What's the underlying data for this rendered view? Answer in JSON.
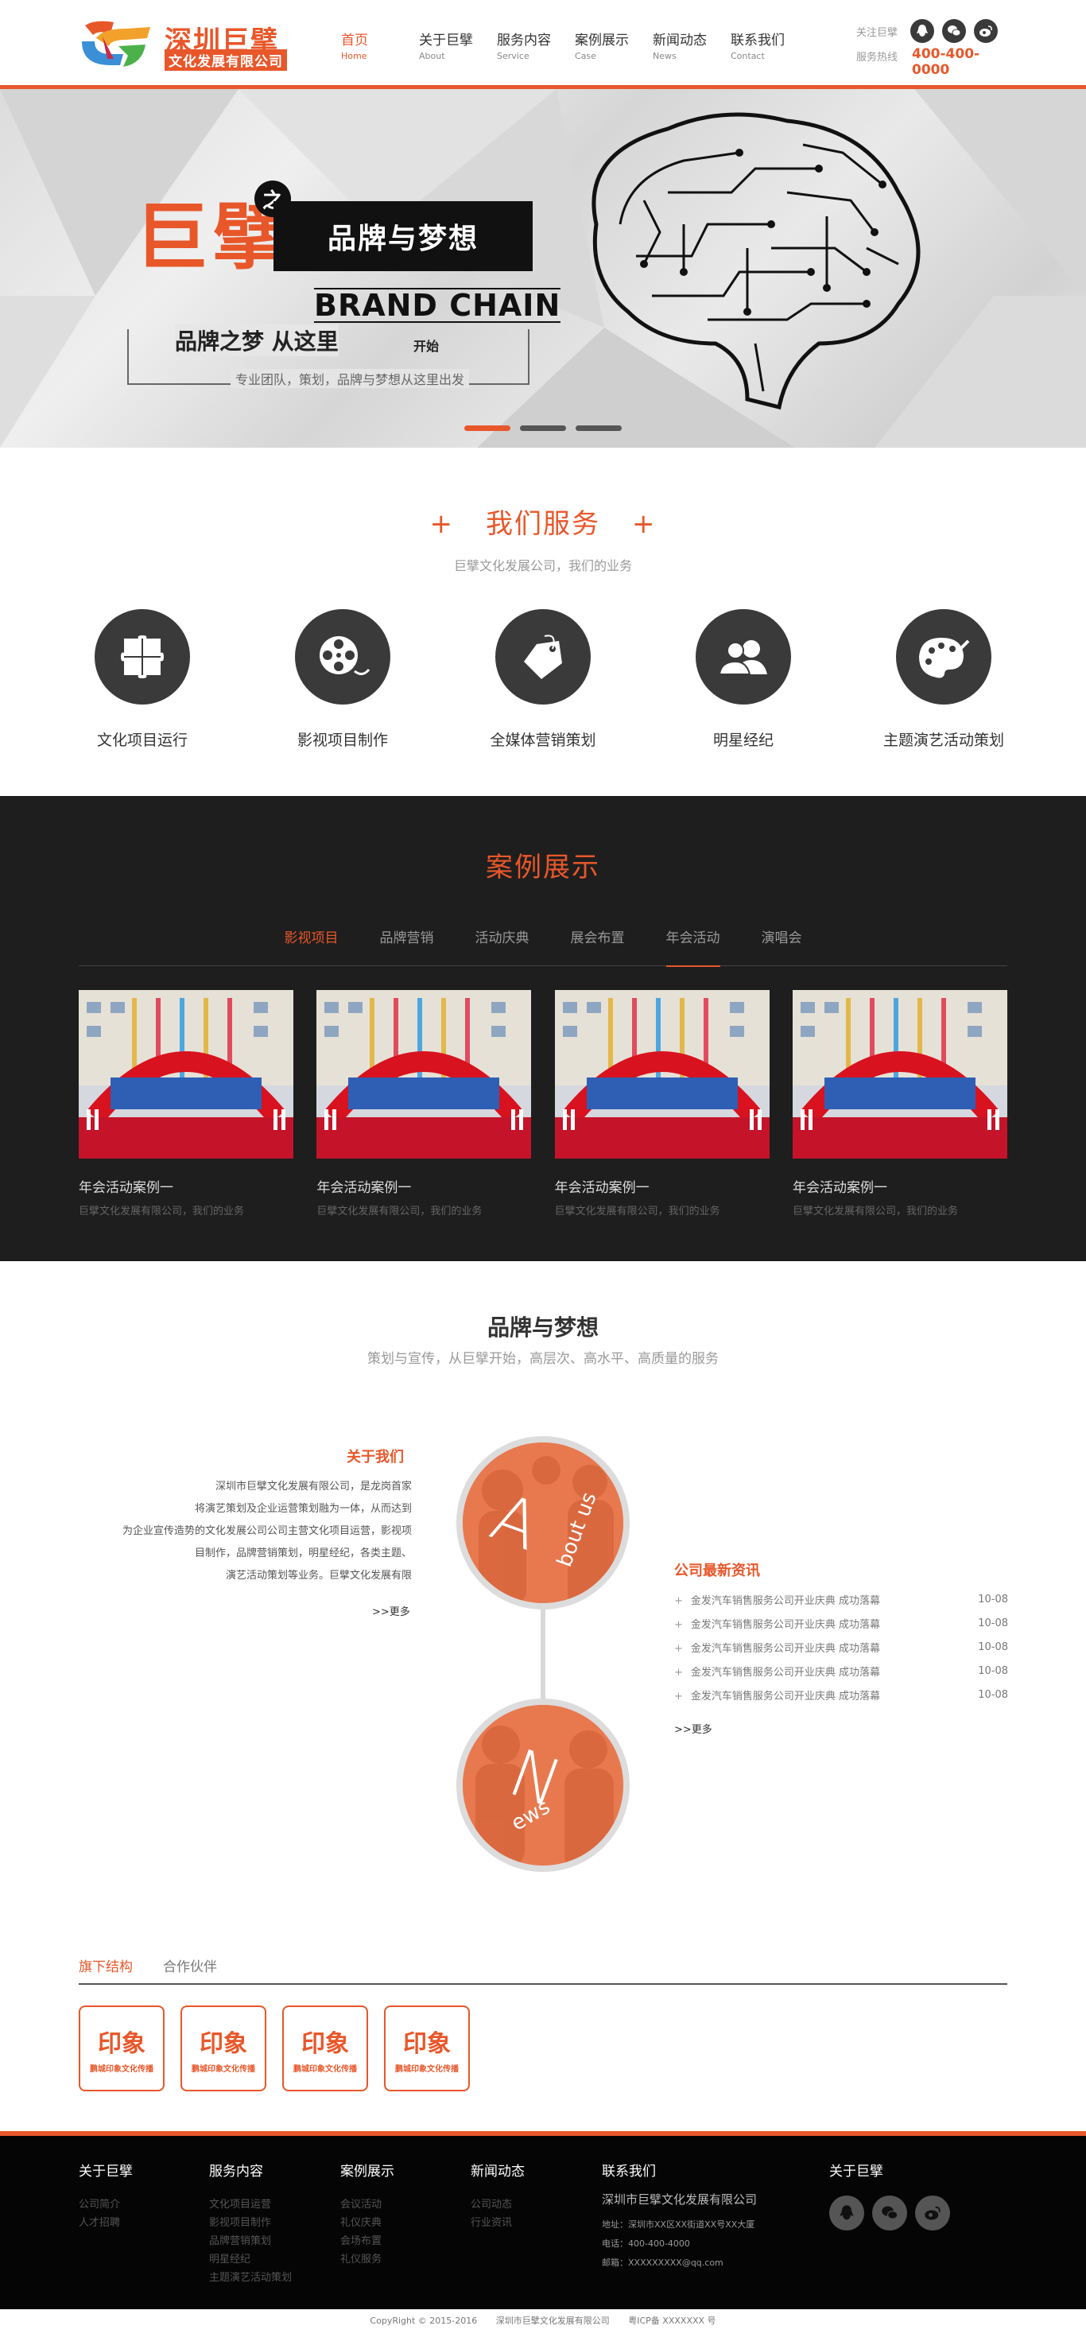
{
  "header": {
    "logo_title": "深圳巨擘",
    "logo_subtitle": "文化发展有限公司",
    "nav": [
      {
        "cn": "首页",
        "en": "Home"
      },
      {
        "cn": "关于巨擘",
        "en": "About"
      },
      {
        "cn": "服务内容",
        "en": "Service"
      },
      {
        "cn": "案例展示",
        "en": "Case"
      },
      {
        "cn": "新闻动态",
        "en": "News"
      },
      {
        "cn": "联系我们",
        "en": "Contact"
      }
    ],
    "follow_label": "关注巨擘",
    "hotline_label": "服务热线",
    "hotline": "400-400-0000",
    "icons": [
      "qq-icon",
      "wechat-icon",
      "weibo-icon"
    ]
  },
  "banner": {
    "big_char": "巨擘",
    "zhi": "之",
    "black_title": "品牌与梦想",
    "english": "BRAND CHAIN",
    "slogan": "品牌之梦 从这里",
    "slogan_small": "开始",
    "sub": "专业团队，策划，品牌与梦想从这里出发",
    "slides": 3,
    "active_slide": 0
  },
  "services": {
    "title": "我们服务",
    "plus": "+",
    "subtitle": "巨擘文化发展公司，我们的业务",
    "items": [
      {
        "label": "文化项目运行",
        "icon": "puzzle-icon"
      },
      {
        "label": "影视项目制作",
        "icon": "film-reel-icon"
      },
      {
        "label": "全媒体营销策划",
        "icon": "price-tag-icon"
      },
      {
        "label": "明星经纪",
        "icon": "people-icon"
      },
      {
        "label": "主题演艺活动策划",
        "icon": "palette-icon"
      }
    ]
  },
  "cases": {
    "title": "案例展示",
    "tabs": [
      "影视项目",
      "品牌营销",
      "活动庆典",
      "展会布置",
      "年会活动",
      "演唱会"
    ],
    "items": [
      {
        "title": "年会活动案例一",
        "desc": "巨擘文化发展有限公司，我们的业务"
      },
      {
        "title": "年会活动案例一",
        "desc": "巨擘文化发展有限公司，我们的业务"
      },
      {
        "title": "年会活动案例一",
        "desc": "巨擘文化发展有限公司，我们的业务"
      },
      {
        "title": "年会活动案例一",
        "desc": "巨擘文化发展有限公司，我们的业务"
      }
    ]
  },
  "brand": {
    "title": "品牌与梦想",
    "subtitle": "策划与宣传，从巨擘开始，高层次、高水平、高质量的服务",
    "about_title": "关于我们",
    "about_lines": [
      "深圳市巨擘文化发展有限公司，是龙岗首家",
      "将演艺策划及企业运营策划融为一体，从而达到",
      "为企业宣传造势的文化发展公司公司主营文化项目运营，影视项",
      "目制作，品牌营销策划，明星经纪，各类主题、",
      "演艺活动策划等业务。巨擘文化发展有限"
    ],
    "about_more": ">>更多",
    "circle1": "About us",
    "circle2": "News",
    "news_title": "公司最新资讯",
    "news": [
      {
        "title": "金发汽车销售服务公司开业庆典 成功落幕",
        "date": "10-08"
      },
      {
        "title": "金发汽车销售服务公司开业庆典 成功落幕",
        "date": "10-08"
      },
      {
        "title": "金发汽车销售服务公司开业庆典 成功落幕",
        "date": "10-08"
      },
      {
        "title": "金发汽车销售服务公司开业庆典 成功落幕",
        "date": "10-08"
      },
      {
        "title": "金发汽车销售服务公司开业庆典 成功落幕",
        "date": "10-08"
      }
    ],
    "news_more": ">>更多",
    "sub_tabs": [
      "旗下结构",
      "合作伙伴"
    ]
  },
  "partners": {
    "seal": "印象",
    "caption": "鹏城印象文化传播",
    "count": 4
  },
  "footer": {
    "cols": [
      {
        "title": "关于巨擘",
        "links": [
          "公司简介",
          "人才招聘"
        ]
      },
      {
        "title": "服务内容",
        "links": [
          "文化项目运营",
          "影视项目制作",
          "品牌营销策划",
          "明星经纪",
          "主题演艺活动策划"
        ]
      },
      {
        "title": "案例展示",
        "links": [
          "会议活动",
          "礼仪庆典",
          "会场布置",
          "礼仪服务"
        ]
      },
      {
        "title": "新闻动态",
        "links": [
          "公司动态",
          "行业资讯"
        ]
      }
    ],
    "contact_title": "联系我们",
    "contact_name": "深圳市巨擘文化发展有限公司",
    "contact_lines": [
      "地址：深圳市XX区XX街道XX号XX大厦",
      "电话：400-400-4000",
      "邮箱：XXXXXXXXX@qq.com"
    ],
    "follow_title": "关于巨擘",
    "copyright": "CopyRight © 2015-2016",
    "company": "深圳市巨擘文化发展有限公司",
    "icp": "粤ICP备 XXXXXXX 号"
  }
}
